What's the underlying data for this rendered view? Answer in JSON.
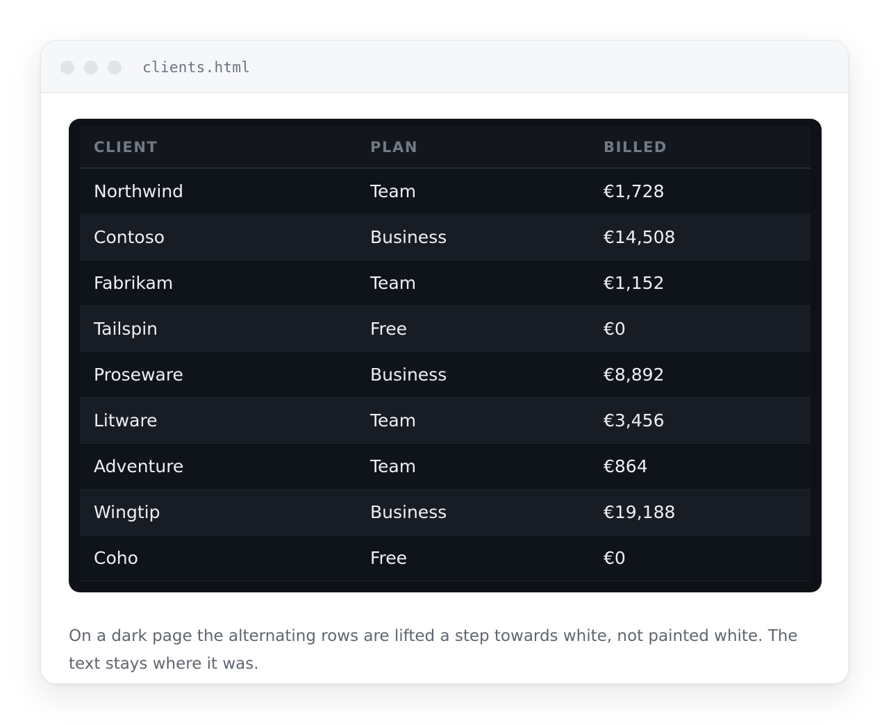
{
  "window": {
    "filename": "clients.html"
  },
  "table": {
    "columns": [
      "CLIENT",
      "PLAN",
      "BILLED"
    ],
    "rows": [
      {
        "client": "Northwind",
        "plan": "Team",
        "billed": "€1,728"
      },
      {
        "client": "Contoso",
        "plan": "Business",
        "billed": "€14,508"
      },
      {
        "client": "Fabrikam",
        "plan": "Team",
        "billed": "€1,152"
      },
      {
        "client": "Tailspin",
        "plan": "Free",
        "billed": "€0"
      },
      {
        "client": "Proseware",
        "plan": "Business",
        "billed": "€8,892"
      },
      {
        "client": "Litware",
        "plan": "Team",
        "billed": "€3,456"
      },
      {
        "client": "Adventure",
        "plan": "Team",
        "billed": "€864"
      },
      {
        "client": "Wingtip",
        "plan": "Business",
        "billed": "€19,188"
      },
      {
        "client": "Coho",
        "plan": "Free",
        "billed": "€0"
      }
    ]
  },
  "caption": "On a dark page the alternating rows are lifted a step towards white, not painted white. The text stays where it was.",
  "colors": {
    "page_background": "#ffffff",
    "table_background": "#0e1116",
    "row_odd": "#0f131a",
    "row_even": "#181d25",
    "header_text": "#717a86",
    "cell_text": "#eef0f3",
    "caption_text": "#5f6670"
  }
}
